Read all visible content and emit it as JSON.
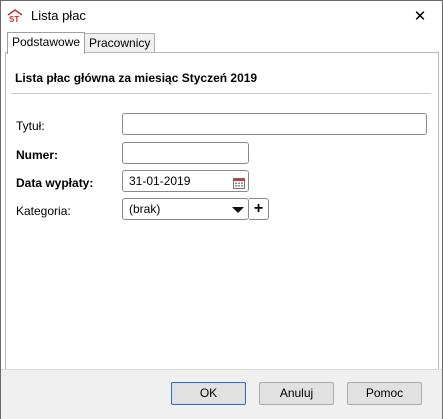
{
  "window": {
    "title": "Lista płac",
    "close_glyph": "✕",
    "app_icon": "payroll-app-icon"
  },
  "tabs": [
    {
      "label": "Podstawowe",
      "active": true
    },
    {
      "label": "Pracownicy",
      "active": false
    }
  ],
  "form": {
    "heading": "Lista płac główna za miesiąc Styczeń 2019",
    "title_label": "Tytuł:",
    "title_value": "",
    "number_label": "Numer:",
    "number_value": "",
    "payment_date_label": "Data wypłaty:",
    "payment_date_value": "31-01-2019",
    "category_label": "Kategoria:",
    "category_value": "(brak)",
    "add_category_glyph": "+"
  },
  "buttons": {
    "ok": "OK",
    "cancel": "Anuluj",
    "help": "Pomoc"
  },
  "colors": {
    "default_button_border": "#3a6fb0",
    "app_icon_red": "#c0392b"
  }
}
